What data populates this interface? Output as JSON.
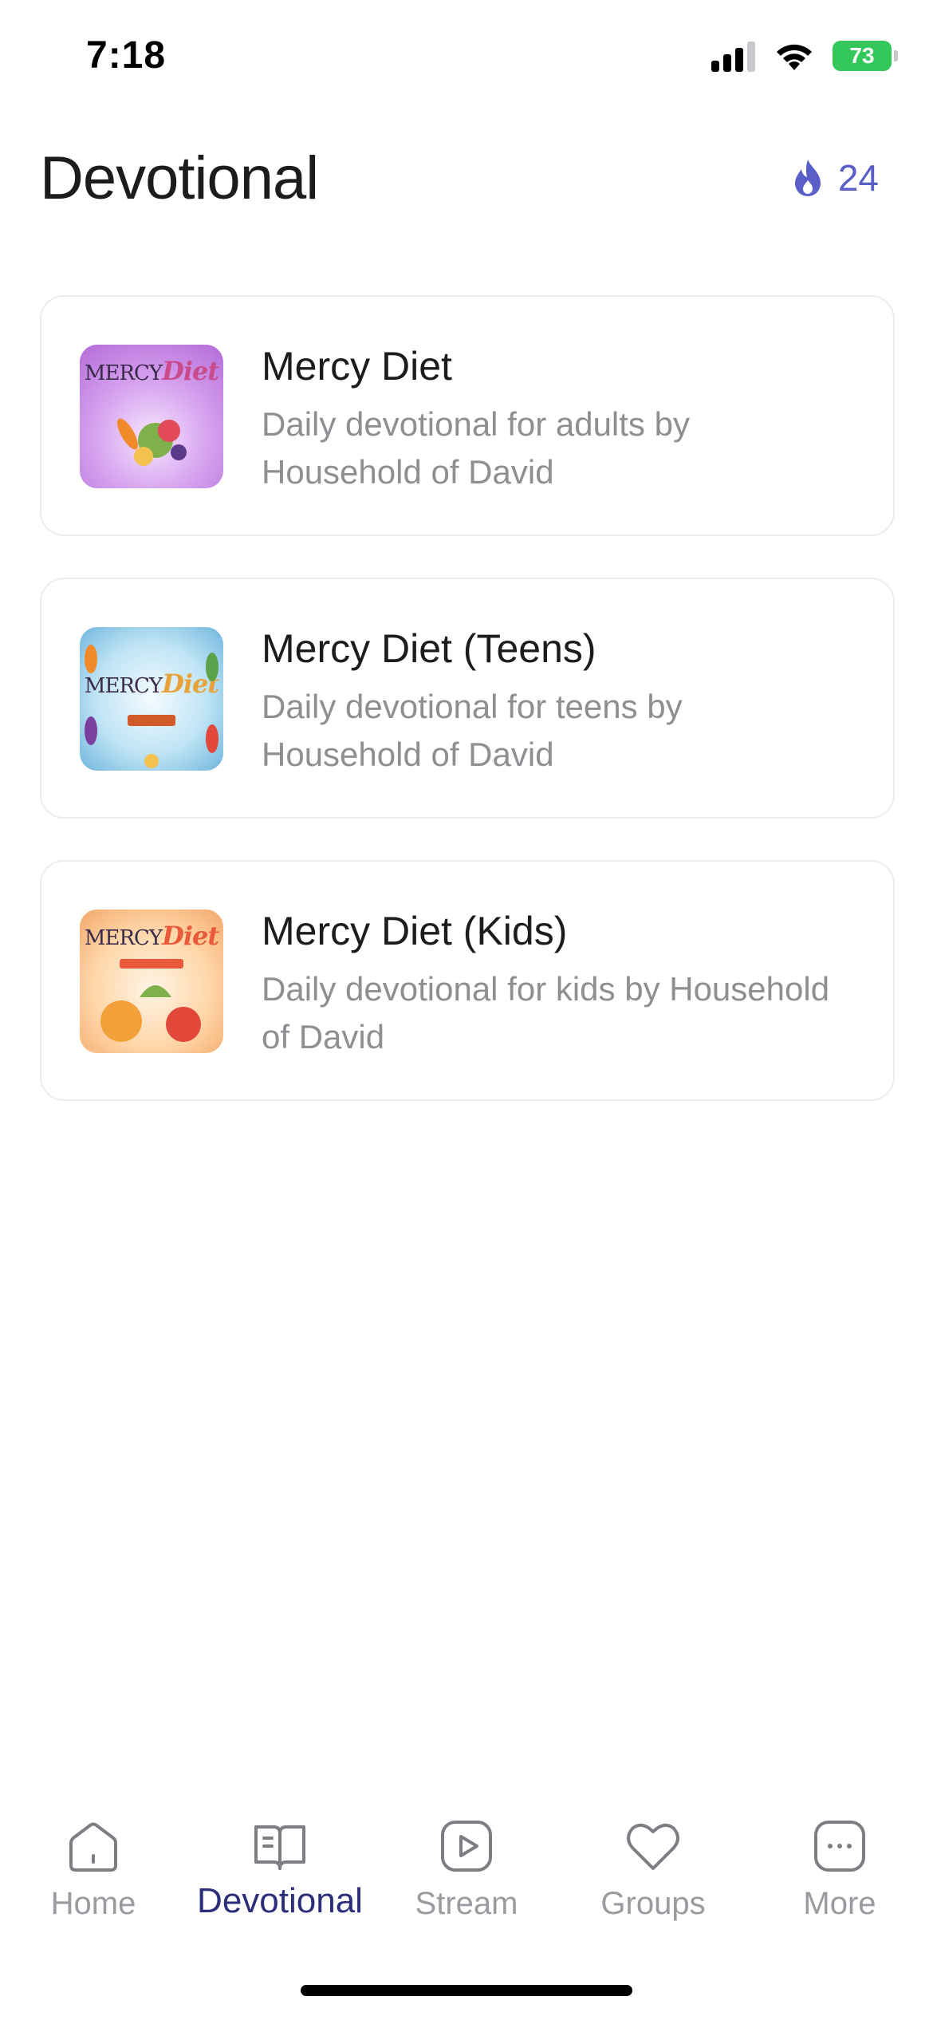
{
  "status_bar": {
    "time": "7:18",
    "battery": "73"
  },
  "header": {
    "title": "Devotional",
    "streak_count": "24",
    "streak_icon": "flame-icon"
  },
  "devotionals": [
    {
      "title": "Mercy Diet",
      "description": "Daily devotional for adults by Household of David",
      "thumb_text_a": "MERCY",
      "thumb_text_b": "Diet"
    },
    {
      "title": "Mercy Diet (Teens)",
      "description": "Daily devotional for teens by Household of David",
      "thumb_text_a": "MERCY",
      "thumb_text_b": "Diet"
    },
    {
      "title": "Mercy Diet (Kids)",
      "description": "Daily devotional for kids by Household of David",
      "thumb_text_a": "MERCY",
      "thumb_text_b": "Diet"
    }
  ],
  "tabs": [
    {
      "label": "Home",
      "icon": "home-icon"
    },
    {
      "label": "Devotional",
      "icon": "book-icon",
      "active": true
    },
    {
      "label": "Stream",
      "icon": "play-icon"
    },
    {
      "label": "Groups",
      "icon": "heart-icon"
    },
    {
      "label": "More",
      "icon": "more-icon"
    }
  ],
  "colors": {
    "accent": "#5a5fc8",
    "active_tab": "#2b2e7a",
    "muted": "#9a9aa0"
  }
}
